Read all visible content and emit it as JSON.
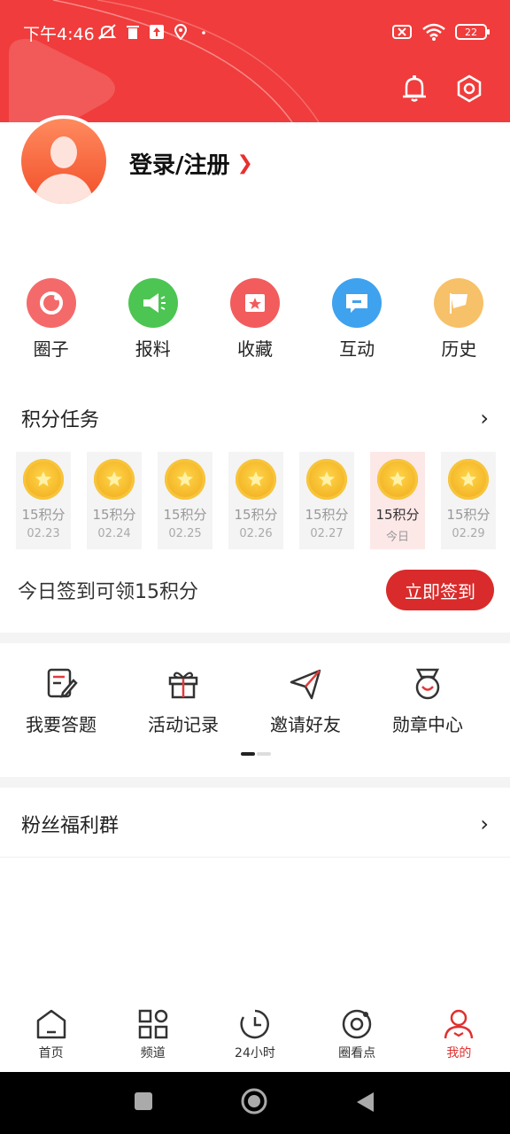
{
  "status_bar": {
    "time": "下午4:46",
    "battery": "22"
  },
  "profile": {
    "login_label": "登录/注册"
  },
  "quick_actions": [
    {
      "label": "圈子",
      "icon": "circle-icon",
      "color": "#f46a6a"
    },
    {
      "label": "报料",
      "icon": "megaphone-icon",
      "color": "#4cc552"
    },
    {
      "label": "收藏",
      "icon": "star-folder-icon",
      "color": "#f25c5c"
    },
    {
      "label": "互动",
      "icon": "chat-icon",
      "color": "#3ea2ef"
    },
    {
      "label": "历史",
      "icon": "flag-icon",
      "color": "#f7c169"
    }
  ],
  "points": {
    "title": "积分任务",
    "days": [
      {
        "points": "15积分",
        "date": "02.23"
      },
      {
        "points": "15积分",
        "date": "02.24"
      },
      {
        "points": "15积分",
        "date": "02.25"
      },
      {
        "points": "15积分",
        "date": "02.26"
      },
      {
        "points": "15积分",
        "date": "02.27"
      },
      {
        "points": "15积分",
        "date": "今日"
      },
      {
        "points": "15积分",
        "date": "02.29"
      }
    ],
    "sign_text": "今日签到可领15积分",
    "sign_button": "立即签到"
  },
  "tools": [
    {
      "label": "我要答题",
      "icon": "edit-icon"
    },
    {
      "label": "活动记录",
      "icon": "gift-icon"
    },
    {
      "label": "邀请好友",
      "icon": "send-icon"
    },
    {
      "label": "勋章中心",
      "icon": "medal-icon"
    }
  ],
  "fans": {
    "title": "粉丝福利群"
  },
  "tabbar": [
    {
      "label": "首页",
      "icon": "home-icon"
    },
    {
      "label": "频道",
      "icon": "grid-icon"
    },
    {
      "label": "24小时",
      "icon": "clock-icon"
    },
    {
      "label": "圈看点",
      "icon": "target-icon"
    },
    {
      "label": "我的",
      "icon": "user-icon"
    }
  ],
  "colors": {
    "brand_red": "#f03c3c",
    "button_red": "#d92b2b",
    "active_tab": "#e03030"
  }
}
